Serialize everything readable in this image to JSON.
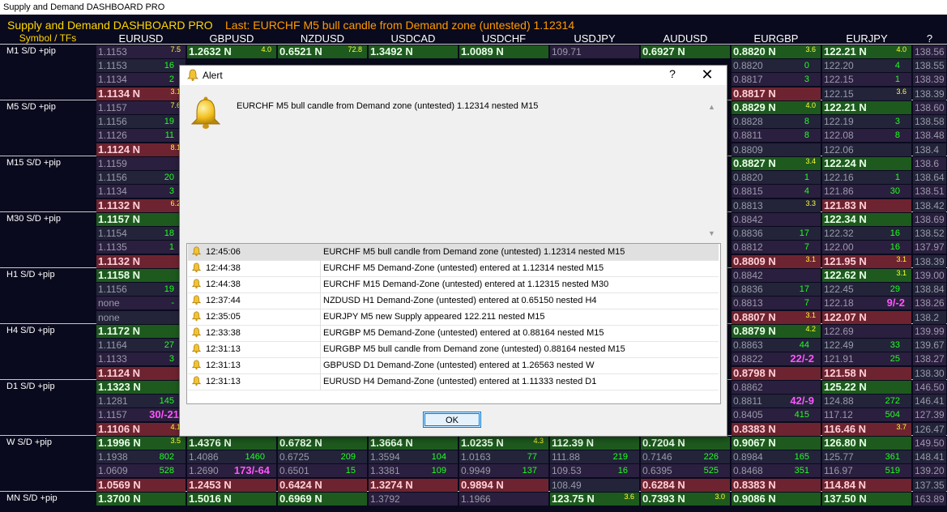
{
  "window_title": "Supply and Demand DASHBOARD PRO",
  "dashboard": {
    "brand": "Supply and Demand DASHBOARD PRO",
    "last_alert": "Last: EURCHF M5 bull candle from Demand zone (untested) 1.12314",
    "symbol_header": "Symbol / TFs",
    "symbols": [
      "EURUSD",
      "GBPUSD",
      "NZDUSD",
      "USDCAD",
      "USDCHF",
      "USDJPY",
      "AUDUSD",
      "EURGBP",
      "EURJPY",
      "?"
    ],
    "timeframes": [
      "M1 S/D +pip",
      "M5 S/D +pip",
      "M15 S/D +pip",
      "M30 S/D +pip",
      "H1 S/D +pip",
      "H4 S/D +pip",
      "D1 S/D +pip",
      "W S/D +pip",
      "MN S/D +pip"
    ],
    "visible_cells": [
      [
        "1.1153",
        "7.5",
        "1.2632 N",
        "4.0",
        "0.6521 N",
        "72.8",
        "1.3492 N",
        "",
        "1.0089 N",
        "",
        "109.71",
        "",
        "0.6927 N",
        "",
        "0.8820 N",
        "3.6",
        "122.21 N",
        "4.0",
        "138.56",
        ""
      ],
      [
        "1.1153",
        "16",
        "",
        "",
        "",
        "",
        "",
        "",
        "",
        "",
        "",
        "",
        "",
        "",
        "0.8820",
        "0",
        "122.20",
        "4",
        "138.55",
        ""
      ],
      [
        "1.1134",
        "2",
        "",
        "",
        "",
        "",
        "",
        "",
        "",
        "",
        "",
        "",
        "",
        "",
        "0.8817",
        "3",
        "122.15",
        "1",
        "138.39",
        ""
      ],
      [
        "1.1134 N",
        "3.1",
        "",
        "",
        "",
        "",
        "",
        "",
        "",
        "",
        "",
        "",
        "",
        "",
        "0.8817 N",
        "",
        "122.15",
        "3.6",
        "138.39",
        ""
      ],
      [
        "1.1157",
        "7.6",
        "",
        "",
        "",
        "",
        "",
        "",
        "",
        "",
        "",
        "",
        "",
        "",
        "0.8829 N",
        "4.0",
        "122.21 N",
        "",
        "138.60",
        ""
      ],
      [
        "1.1156",
        "19",
        "",
        "",
        "",
        "",
        "",
        "",
        "",
        "",
        "",
        "",
        "",
        "",
        "0.8828",
        "8",
        "122.19",
        "3",
        "138.58",
        ""
      ],
      [
        "1.1126",
        "11",
        "",
        "",
        "",
        "",
        "",
        "",
        "",
        "",
        "",
        "",
        "",
        "",
        "0.8811",
        "8",
        "122.08",
        "8",
        "138.48",
        ""
      ],
      [
        "1.1124 N",
        "8.1",
        "",
        "",
        "",
        "",
        "",
        "",
        "",
        "",
        "",
        "",
        "",
        "",
        "0.8809",
        "",
        "122.06",
        "",
        "138.4",
        ""
      ],
      [
        "1.1159",
        "",
        "",
        "",
        "",
        "",
        "",
        "",
        "",
        "",
        "",
        "",
        "",
        "",
        "0.8827 N",
        "3.4",
        "122.24 N",
        "",
        "138.6",
        ""
      ],
      [
        "1.1156",
        "20",
        "",
        "",
        "",
        "",
        "",
        "",
        "",
        "",
        "",
        "",
        "",
        "",
        "0.8820",
        "1",
        "122.16",
        "1",
        "138.64",
        ""
      ],
      [
        "1.1134",
        "3",
        "",
        "",
        "",
        "",
        "",
        "",
        "",
        "",
        "",
        "",
        "",
        "",
        "0.8815",
        "4",
        "121.86",
        "30",
        "138.51",
        ""
      ],
      [
        "1.1132 N",
        "6.2",
        "",
        "",
        "",
        "",
        "",
        "",
        "",
        "",
        "",
        "",
        "",
        "",
        "0.8813",
        "3.3",
        "121.83 N",
        "",
        "138.42",
        ""
      ],
      [
        "1.1157 N",
        "",
        "",
        "",
        "",
        "",
        "",
        "",
        "",
        "",
        "",
        "",
        "",
        "",
        "0.8842",
        "",
        "122.34 N",
        "",
        "138.69",
        ""
      ],
      [
        "1.1154",
        "18",
        "",
        "",
        "",
        "",
        "",
        "",
        "",
        "",
        "",
        "",
        "",
        "",
        "0.8836",
        "17",
        "122.32",
        "16",
        "138.52",
        ""
      ],
      [
        "1.1135",
        "1",
        "",
        "",
        "",
        "",
        "",
        "",
        "",
        "",
        "",
        "",
        "",
        "",
        "0.8812",
        "7",
        "122.00",
        "16",
        "137.97",
        ""
      ],
      [
        "1.1132 N",
        "",
        "",
        "",
        "",
        "",
        "",
        "",
        "",
        "",
        "",
        "",
        "",
        "",
        "0.8809 N",
        "3.1",
        "121.95 N",
        "3.1",
        "138.39",
        ""
      ],
      [
        "1.1158 N",
        "",
        "",
        "",
        "",
        "",
        "",
        "",
        "",
        "",
        "",
        "",
        "",
        "",
        "0.8842",
        "",
        "122.62 N",
        "3.1",
        "139.00",
        ""
      ],
      [
        "1.1156",
        "19",
        "",
        "",
        "",
        "",
        "",
        "",
        "",
        "",
        "",
        "",
        "",
        "",
        "0.8836",
        "17",
        "122.45",
        "29",
        "138.84",
        ""
      ],
      [
        "none",
        "-",
        "",
        "",
        "",
        "",
        "",
        "",
        "",
        "",
        "",
        "",
        "",
        "",
        "0.8813",
        "7",
        "122.18",
        "9/-2",
        "138.26",
        ""
      ],
      [
        "none",
        "",
        "",
        "",
        "",
        "",
        "",
        "",
        "",
        "",
        "",
        "",
        "",
        "",
        "0.8807 N",
        "3.1",
        "122.07 N",
        "",
        "138.2",
        ""
      ],
      [
        "1.1172 N",
        "",
        "",
        "",
        "",
        "",
        "",
        "",
        "",
        "",
        "",
        "",
        "",
        "",
        "0.8879 N",
        "4.2",
        "122.69",
        "",
        "139.99",
        ""
      ],
      [
        "1.1164",
        "27",
        "",
        "",
        "",
        "",
        "",
        "",
        "",
        "",
        "",
        "",
        "",
        "",
        "0.8863",
        "44",
        "122.49",
        "33",
        "139.67",
        ""
      ],
      [
        "1.1133",
        "3",
        "",
        "",
        "",
        "",
        "",
        "",
        "",
        "",
        "",
        "",
        "",
        "",
        "0.8822",
        "22/-2",
        "121.91",
        "25",
        "138.27",
        ""
      ],
      [
        "1.1124 N",
        "",
        "",
        "",
        "",
        "",
        "",
        "",
        "",
        "",
        "",
        "",
        "",
        "",
        "0.8798 N",
        "",
        "121.58 N",
        "",
        "138.30",
        ""
      ],
      [
        "1.1323 N",
        "",
        "",
        "",
        "",
        "",
        "",
        "",
        "",
        "",
        "",
        "",
        "",
        "",
        "0.8862",
        "",
        "125.22 N",
        "",
        "146.50",
        ""
      ],
      [
        "1.1281",
        "145",
        "",
        "",
        "",
        "",
        "",
        "",
        "",
        "",
        "",
        "",
        "",
        "",
        "0.8811",
        "42/-9",
        "124.88",
        "272",
        "146.41",
        ""
      ],
      [
        "1.1157",
        "30/-21",
        "",
        "",
        "",
        "",
        "",
        "",
        "",
        "",
        "",
        "",
        "",
        "",
        "0.8405",
        "415",
        "117.12",
        "504",
        "127.39",
        ""
      ],
      [
        "1.1106 N",
        "4.1",
        "",
        "",
        "",
        "",
        "",
        "",
        "",
        "",
        "",
        "",
        "",
        "",
        "0.8383 N",
        "",
        "116.46 N",
        "3.7",
        "126.47",
        ""
      ],
      [
        "1.1996 N",
        "3.5",
        "1.4376 N",
        "",
        "0.6782 N",
        "",
        "1.3664 N",
        "",
        "1.0235 N",
        "4.3",
        "112.39 N",
        "",
        "0.7204 N",
        "",
        "0.9067 N",
        "",
        "126.80 N",
        "",
        "149.50",
        ""
      ],
      [
        "1.1938",
        "802",
        "1.4086",
        "1460",
        "0.6725",
        "209",
        "1.3594",
        "104",
        "1.0163",
        "77",
        "111.88",
        "219",
        "0.7146",
        "226",
        "0.8984",
        "165",
        "125.77",
        "361",
        "148.41",
        ""
      ],
      [
        "1.0609",
        "528",
        "1.2690",
        "173/-64",
        "0.6501",
        "15",
        "1.3381",
        "109",
        "0.9949",
        "137",
        "109.53",
        "16",
        "0.6395",
        "525",
        "0.8468",
        "351",
        "116.97",
        "519",
        "139.20",
        ""
      ],
      [
        "1.0569 N",
        "",
        "1.2453 N",
        "",
        "0.6424 N",
        "",
        "1.3274 N",
        "",
        "0.9894 N",
        "",
        "108.49",
        "",
        "0.6284 N",
        "",
        "0.8383 N",
        "",
        "114.84 N",
        "",
        "137.35",
        ""
      ],
      [
        "1.3700 N",
        "",
        "1.5016 N",
        "",
        "0.6969 N",
        "",
        "1.3792",
        "",
        "1.1966",
        "",
        "123.75 N",
        "3.6",
        "0.7393 N",
        "3.0",
        "0.9086 N",
        "",
        "137.50 N",
        "",
        "163.89",
        ""
      ]
    ]
  },
  "alert": {
    "title": "Alert",
    "help_label": "?",
    "close_label": "✕",
    "message": "EURCHF M5 bull candle from Demand zone (untested) 1.12314 nested M15",
    "ok_label": "OK",
    "log": [
      {
        "time": "12:45:06",
        "text": "EURCHF M5 bull candle from Demand zone (untested) 1.12314 nested M15",
        "selected": true
      },
      {
        "time": "12:44:38",
        "text": "EURCHF M5 Demand-Zone (untested) entered at 1.12314 nested M15",
        "selected": false
      },
      {
        "time": "12:44:38",
        "text": "EURCHF M15 Demand-Zone (untested) entered at 1.12315 nested M30",
        "selected": false
      },
      {
        "time": "12:37:44",
        "text": "NZDUSD H1 Demand-Zone (untested) entered at 0.65150 nested H4",
        "selected": false
      },
      {
        "time": "12:35:05",
        "text": "EURJPY M5 new Supply appeared 122.211 nested M15",
        "selected": false
      },
      {
        "time": "12:33:38",
        "text": "EURGBP M5 Demand-Zone (untested) entered at 0.88164 nested M15",
        "selected": false
      },
      {
        "time": "12:31:13",
        "text": "EURGBP M5 bull candle from Demand zone (untested) 0.88164 nested M15",
        "selected": false
      },
      {
        "time": "12:31:13",
        "text": "GBPUSD D1 Demand-Zone (untested) entered at 1.26563 nested W",
        "selected": false
      },
      {
        "time": "12:31:13",
        "text": "EURUSD H4 Demand-Zone (untested) entered at 1.11333 nested D1",
        "selected": false
      }
    ]
  },
  "colors": {
    "background": "#0a0a1e",
    "brand": "#ffd700",
    "last_alert": "#ff9a00",
    "zone_green": "#1e5a1e",
    "zone_red": "#6e2430",
    "pip_green": "#22ff22",
    "pip_yellow": "#ffff33",
    "pip_magenta": "#ff55ff"
  }
}
